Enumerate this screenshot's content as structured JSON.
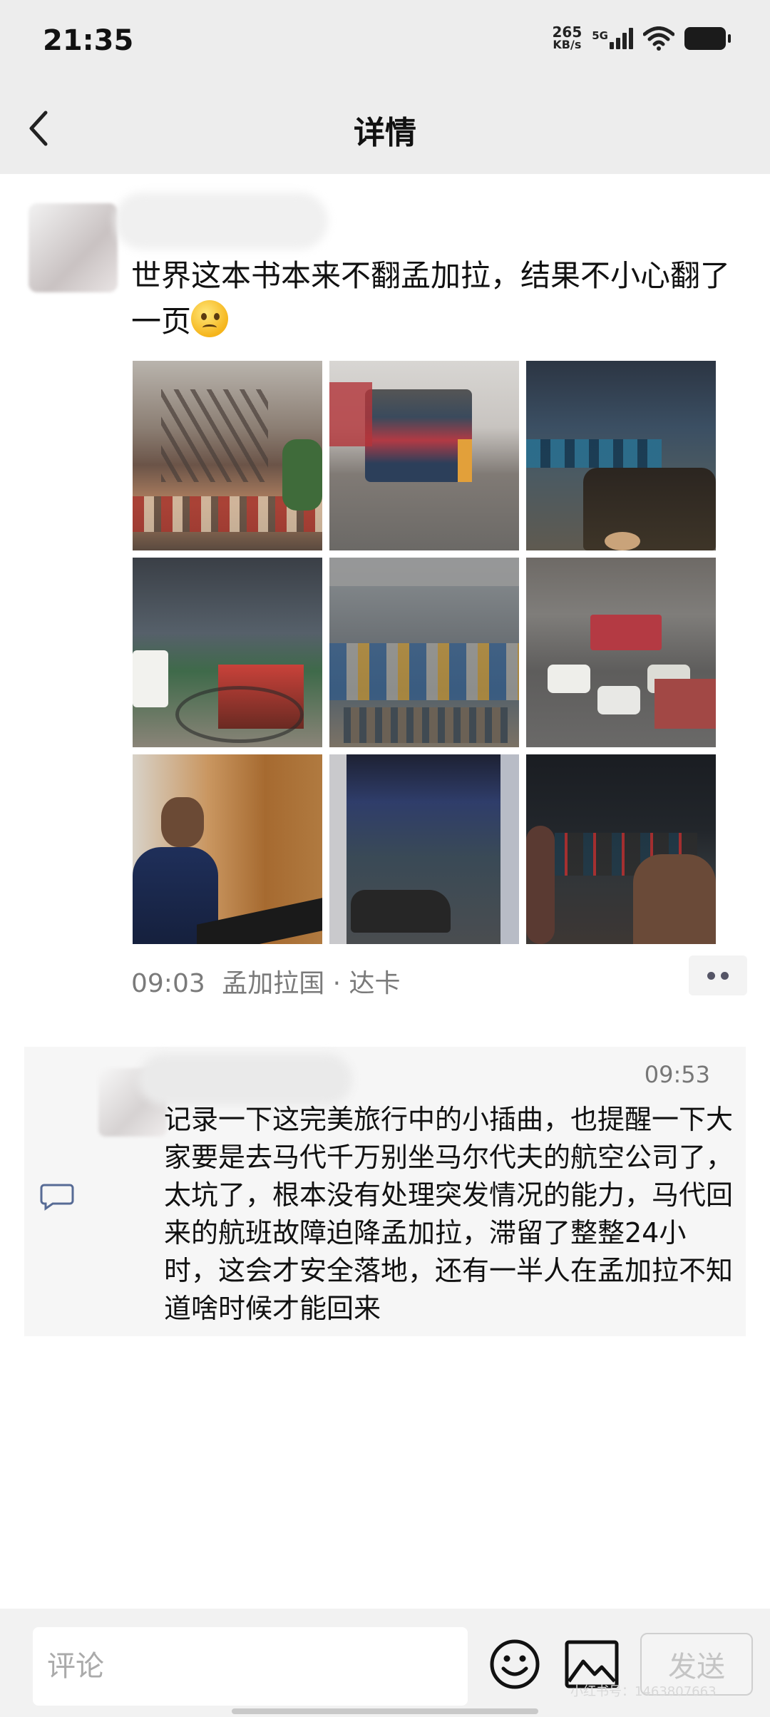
{
  "status_bar": {
    "time": "21:35",
    "speed_value": "265",
    "speed_unit": "KB/s",
    "network": "5G",
    "icons": [
      "signal-icon",
      "wifi-icon",
      "battery-icon"
    ]
  },
  "nav": {
    "title": "详情",
    "back_icon": "chevron-left-icon"
  },
  "post": {
    "text": "世界这本书本来不翻孟加拉，结果不小心翻了一页",
    "emoji": "flushed-face-emoji",
    "photos": [
      "photo-street-overpass",
      "photo-bus-street",
      "photo-night-traffic",
      "photo-rickshaw",
      "photo-aerial-market",
      "photo-aerial-road",
      "photo-man-hotel-lobby",
      "photo-window-traffic",
      "photo-car-interior-night"
    ],
    "time": "09:03",
    "location": "孟加拉国 · 达卡"
  },
  "comments": [
    {
      "time": "09:53",
      "text": "记录一下这完美旅行中的小插曲，也提醒一下大家要是去马代千万别坐马尔代夫的航空公司了，太坑了，根本没有处理突发情况的能力，马代回来的航班故障迫降孟加拉，滞留了整整24小时，这会才安全落地，还有一半人在孟加拉不知道啥时候才能回来"
    }
  ],
  "bottom": {
    "comment_placeholder": "评论",
    "send_label": "发送",
    "watermark": "小红书号：1463807663"
  },
  "colors": {
    "background": "#ffffff",
    "top_bar": "#ededed",
    "meta_text": "#7a7a7a",
    "comment_bg": "#f6f6f6",
    "link_blue": "#576b95"
  }
}
